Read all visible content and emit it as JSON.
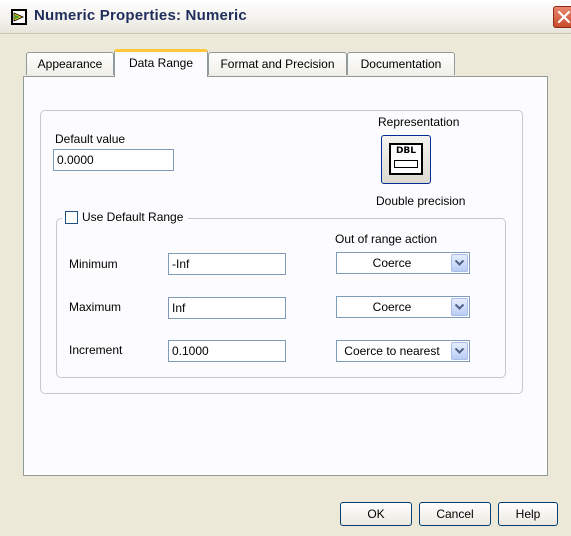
{
  "window": {
    "title": "Numeric Properties: Numeric",
    "icon": "labview-run-icon",
    "close_icon": "close-icon"
  },
  "tabs": [
    {
      "label": "Appearance",
      "active": false
    },
    {
      "label": "Data Range",
      "active": true
    },
    {
      "label": "Format and Precision",
      "active": false
    },
    {
      "label": "Documentation",
      "active": false
    }
  ],
  "data_range": {
    "default_value": {
      "label": "Default value",
      "value": "0.0000"
    },
    "representation": {
      "label": "Representation",
      "icon_text": "DBL",
      "type_label": "Double precision"
    },
    "use_default_range": {
      "label": "Use Default Range",
      "checked": false
    },
    "out_of_range_label": "Out of range action",
    "rows": [
      {
        "label": "Minimum",
        "value": "-Inf",
        "action": "Coerce"
      },
      {
        "label": "Maximum",
        "value": "Inf",
        "action": "Coerce"
      },
      {
        "label": "Increment",
        "value": "0.1000",
        "action": "Coerce to nearest"
      }
    ]
  },
  "buttons": {
    "ok": "OK",
    "cancel": "Cancel",
    "help": "Help"
  },
  "colors": {
    "dialog_bg": "#ece9d8",
    "panel_bg": "#fcfcfe",
    "active_tab_accent": "#ffc73c",
    "title_text": "#1e2d5c",
    "close_button": "#c94a2c"
  }
}
